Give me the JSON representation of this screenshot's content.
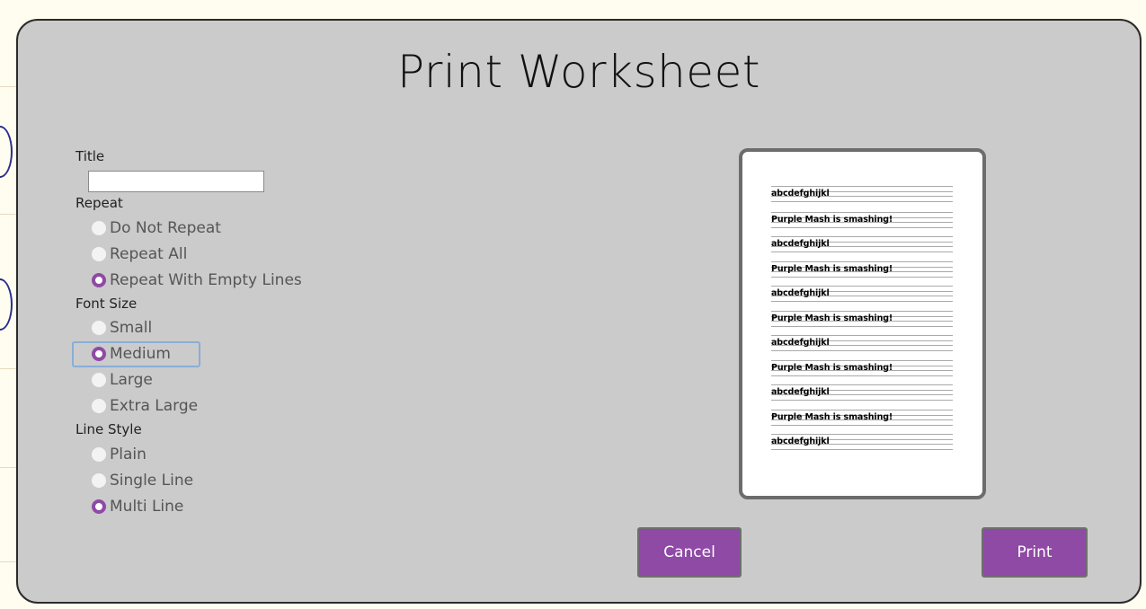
{
  "dialog": {
    "title": "Print Worksheet",
    "title_field": {
      "label": "Title",
      "value": ""
    },
    "repeat": {
      "label": "Repeat",
      "options": [
        {
          "label": "Do Not Repeat",
          "selected": false
        },
        {
          "label": "Repeat All",
          "selected": false
        },
        {
          "label": "Repeat With Empty Lines",
          "selected": true
        }
      ]
    },
    "font_size": {
      "label": "Font Size",
      "options": [
        {
          "label": "Small",
          "selected": false
        },
        {
          "label": "Medium",
          "selected": true
        },
        {
          "label": "Large",
          "selected": false
        },
        {
          "label": "Extra Large",
          "selected": false
        }
      ]
    },
    "line_style": {
      "label": "Line Style",
      "options": [
        {
          "label": "Plain",
          "selected": false
        },
        {
          "label": "Single Line",
          "selected": false
        },
        {
          "label": "Multi Line",
          "selected": true
        }
      ]
    },
    "preview_lines": [
      "abcdefghijkl",
      "Purple Mash is smashing!",
      "abcdefghijkl",
      "Purple Mash is smashing!",
      "abcdefghijkl",
      "Purple Mash is smashing!",
      "abcdefghijkl",
      "Purple Mash is smashing!",
      "abcdefghijkl",
      "Purple Mash is smashing!",
      "abcdefghijkl"
    ],
    "buttons": {
      "cancel": "Cancel",
      "print": "Print"
    },
    "colors": {
      "accent": "#8e4aa5",
      "dialog_bg": "#cbcbcb",
      "page_bg": "#fffdf0"
    }
  }
}
